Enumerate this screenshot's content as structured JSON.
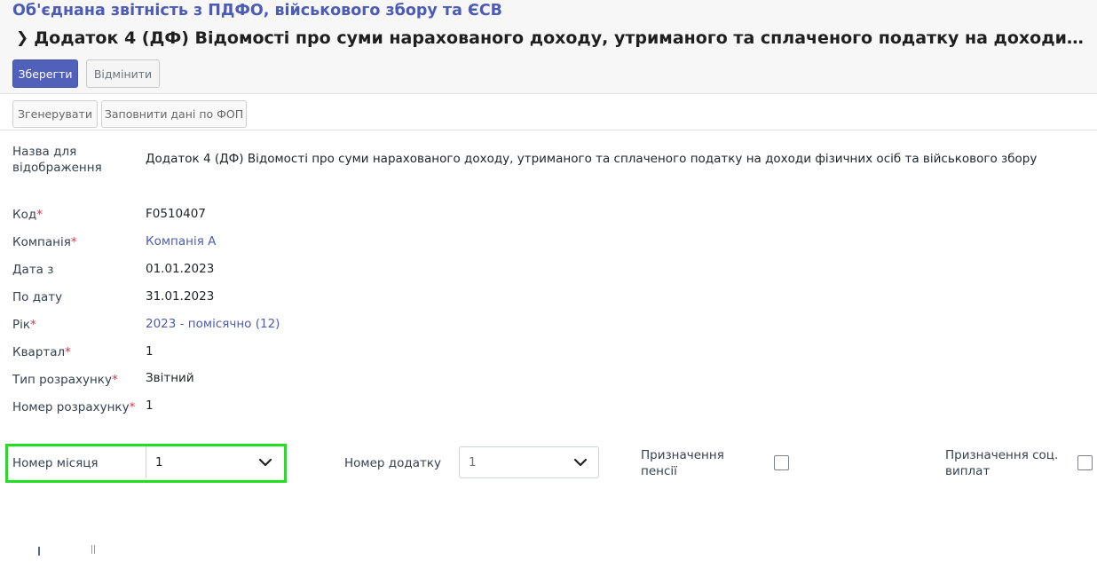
{
  "header": {
    "breadcrumb": "Об'єднана звітність з ПДФО, військового збору та ЄСВ",
    "title": "Додаток 4 (ДФ) Відомості про суми нарахованого доходу, утриманого та сплаченого податку на доходи фізичних осіб та військового збору"
  },
  "toolbar": {
    "save": "Зберегти",
    "discard": "Відмінити"
  },
  "statusbar": {
    "generate": "Згенерувати",
    "fill_fop": "Заповнити дані по ФОП"
  },
  "fields": {
    "display_name": {
      "label_line1": "Назва для",
      "label_line2": "відображення",
      "value": "Додаток 4 (ДФ) Відомості про суми нарахованого доходу, утриманого та сплаченого податку на доходи фізичних осіб та військового збору"
    },
    "code": {
      "label": "Код",
      "value": "F0510407"
    },
    "company": {
      "label": "Компанія",
      "value": "Компанія А"
    },
    "date_from": {
      "label": "Дата з",
      "value": "01.01.2023"
    },
    "date_to": {
      "label": "По дату",
      "value": "31.01.2023"
    },
    "year": {
      "label": "Рік",
      "value": "2023 - помісячно (12)"
    },
    "quarter": {
      "label": "Квартал",
      "value": "1"
    },
    "calc_type": {
      "label": "Тип розрахунку",
      "value": "Звітний"
    },
    "calc_number": {
      "label": "Номер розрахунку",
      "value": "1"
    },
    "month_number": {
      "label": "Номер місяця",
      "value": "1"
    },
    "appendix_number": {
      "label": "Номер додатку",
      "value": "1"
    },
    "pension": {
      "label_line1": "Призначення",
      "label_line2": "пенсії",
      "checked": false
    },
    "social": {
      "label_line1": "Призначення соц.",
      "label_line2": "виплат",
      "checked": false
    }
  },
  "required_mark": "*",
  "colors": {
    "accent": "#5160b8",
    "link": "#4c5cb4",
    "required": "#dc3545",
    "highlight": "#1fe21f"
  },
  "icons": {
    "breadcrumb_sep": "chevron-right-icon",
    "select": "chevron-down-icon"
  }
}
